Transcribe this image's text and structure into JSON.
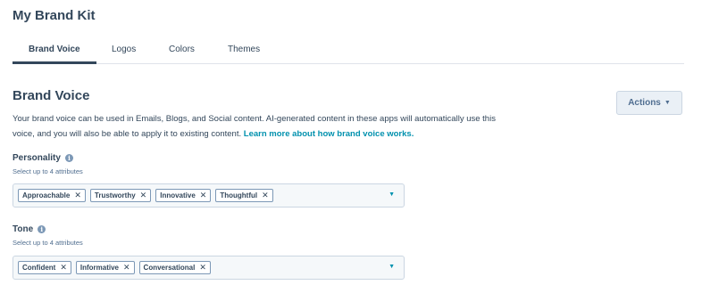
{
  "header": {
    "title": "My Brand Kit"
  },
  "tabs": [
    {
      "label": "Brand Voice",
      "active": true
    },
    {
      "label": "Logos",
      "active": false
    },
    {
      "label": "Colors",
      "active": false
    },
    {
      "label": "Themes",
      "active": false
    }
  ],
  "section": {
    "title": "Brand Voice",
    "actions_label": "Actions",
    "description": "Your brand voice can be used in Emails, Blogs, and Social content. AI-generated content in these apps will automatically use this voice, and you will also be able to apply it to existing content. ",
    "learn_more": "Learn more about how brand voice works."
  },
  "personality": {
    "label": "Personality",
    "help": "Select up to 4 attributes",
    "chips": [
      "Approachable",
      "Trustworthy",
      "Innovative",
      "Thoughtful"
    ]
  },
  "tone": {
    "label": "Tone",
    "help": "Select up to 4 attributes",
    "chips": [
      "Confident",
      "Informative",
      "Conversational"
    ]
  },
  "icons": {
    "remove": "close-icon",
    "info": "info-icon",
    "dropdown": "chevron-down-icon"
  },
  "colors": {
    "accent": "#0091ae",
    "text": "#33475b",
    "field_bg": "#f5f8fa"
  }
}
